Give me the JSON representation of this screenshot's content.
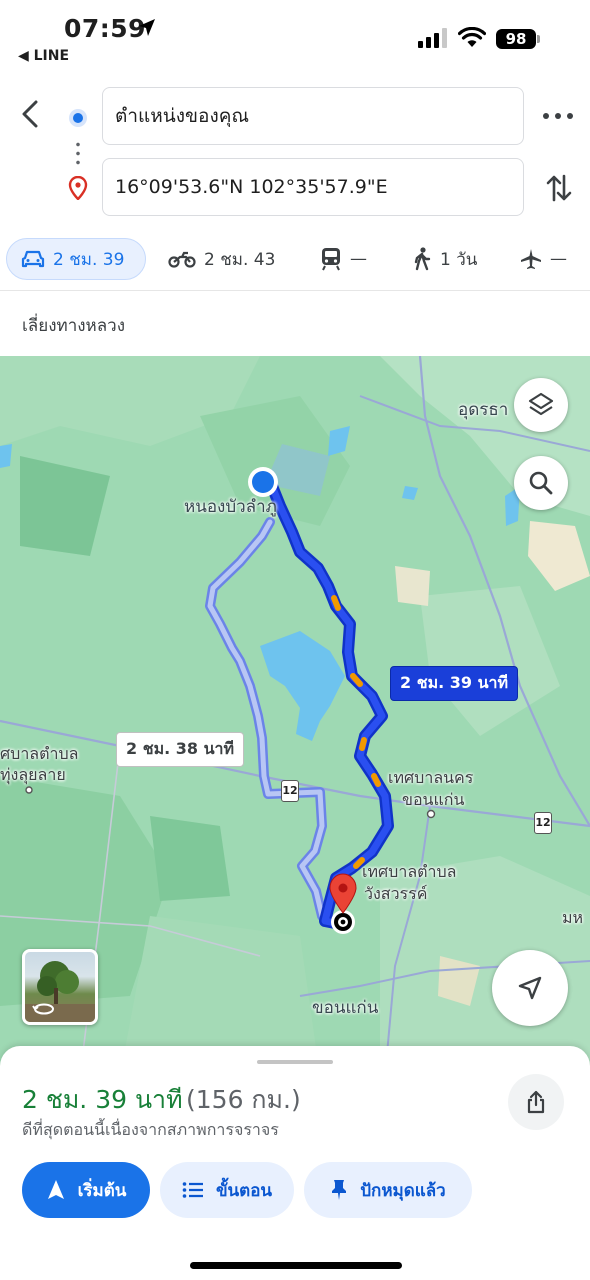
{
  "status": {
    "time": "07:59",
    "back_app": "◀ LINE",
    "battery": "98"
  },
  "directions": {
    "origin": "ตำแหน่งของคุณ",
    "destination": "16°09'53.6\"N 102°35'57.9\"E"
  },
  "modes": [
    {
      "name": "car",
      "label": "2 ชม. 39",
      "icon": "car-icon",
      "active": true
    },
    {
      "name": "motorbike",
      "label": "2 ชม. 43",
      "icon": "motorbike-icon",
      "active": false
    },
    {
      "name": "transit",
      "label": "—",
      "icon": "train-icon",
      "active": false
    },
    {
      "name": "walk",
      "label": "1 วัน",
      "icon": "walk-icon",
      "active": false
    },
    {
      "name": "flight",
      "label": "—",
      "icon": "plane-icon",
      "active": false
    }
  ],
  "options": {
    "avoid_label": "เลี่ยงทางหลวง"
  },
  "map": {
    "labels": {
      "udon": "อุดรธา",
      "nongbua": "หนองบัวลำภู",
      "tungluilai_1": "ศบาลตำบล",
      "tungluilai_2": "ทุ่งลุยลาย",
      "khonkaen_city_1": "เทศบาลนคร",
      "khonkaen_city_2": "ขอนแก่น",
      "wangsawan_1": "เทศบาลตำบล",
      "wangsawan_2": "วังสวรรค์",
      "khonkaen_prov": "ขอนแก่น",
      "edge_right": "มห"
    },
    "route_primary": "2 ชม. 39 นาที",
    "route_alt": "2 ชม. 38 นาที",
    "highway_number": "12"
  },
  "summary": {
    "duration": "2 ชม. 39 นาที",
    "distance": "(156 กม.)",
    "note": "ดีที่สุดตอนนี้เนื่องจากสภาพการจราจร"
  },
  "actions": {
    "start": "เริ่มต้น",
    "steps": "ขั้นตอน",
    "pinned": "ปักหมุดแล้ว"
  },
  "colors": {
    "primary_route": "#1a3fd9",
    "alt_route": "#a6b8f0",
    "accent": "#1a73e8",
    "duration_green": "#188038"
  }
}
